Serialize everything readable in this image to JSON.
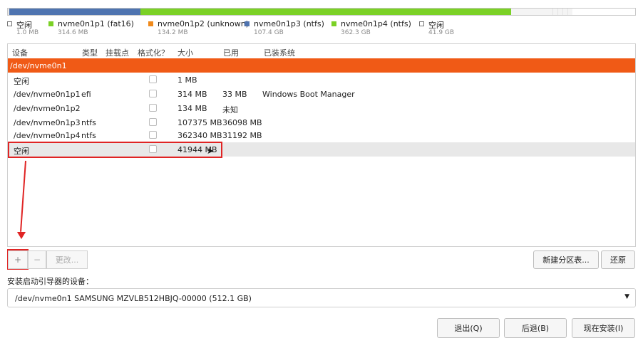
{
  "partition_bar": [
    {
      "color": "#e7e7e7",
      "fraction": 0.0019
    },
    {
      "color": "#4f74b0",
      "fraction": 0.21
    },
    {
      "color": "#7bd126",
      "fraction": 0.59
    },
    {
      "color": "#f4f4f4",
      "fraction": 0.06
    },
    {
      "color": "#f4f4f4",
      "fraction": 0.0381,
      "free": true
    }
  ],
  "legend": [
    {
      "name": "空闲",
      "size": "1.0 MB",
      "color": "#ffffff",
      "free": true
    },
    {
      "name": "nvme0n1p1 (fat16)",
      "size": "314.6 MB",
      "color": "#7bd126"
    },
    {
      "name": "nvme0n1p2 (unknown)",
      "size": "134.2 MB",
      "color": "#f08a1c"
    },
    {
      "name": "nvme0n1p3 (ntfs)",
      "size": "107.4 GB",
      "color": "#4f74b0"
    },
    {
      "name": "nvme0n1p4 (ntfs)",
      "size": "362.3 GB",
      "color": "#7bd126"
    },
    {
      "name": "空闲",
      "size": "41.9 GB",
      "color": "#ffffff",
      "free": true
    }
  ],
  "table": {
    "headers": {
      "device": "设备",
      "type": "类型",
      "mount": "挂载点",
      "format": "格式化？",
      "size": "大小",
      "used": "已用",
      "system": "已装系统"
    },
    "device_row": "/dev/nvme0n1",
    "rows": [
      {
        "device": "空闲",
        "type": "",
        "size": "1 MB",
        "used": "",
        "system": ""
      },
      {
        "device": "/dev/nvme0n1p1",
        "type": "efi",
        "size": "314 MB",
        "used": "33 MB",
        "system": "Windows Boot Manager"
      },
      {
        "device": "/dev/nvme0n1p2",
        "type": "",
        "size": "134 MB",
        "used": "未知",
        "system": ""
      },
      {
        "device": "/dev/nvme0n1p3",
        "type": "ntfs",
        "size": "107375 MB",
        "used": "36098 MB",
        "system": ""
      },
      {
        "device": "/dev/nvme0n1p4",
        "type": "ntfs",
        "size": "362340 MB",
        "used": "31192 MB",
        "system": ""
      },
      {
        "device": "空闲",
        "type": "",
        "size": "41944 MB",
        "used": "",
        "system": ""
      }
    ]
  },
  "toolbar": {
    "add": "+",
    "remove": "−",
    "change": "更改...",
    "new_table": "新建分区表...",
    "revert": "还原"
  },
  "bootloader": {
    "label": "安装启动引导器的设备：",
    "value": "/dev/nvme0n1     SAMSUNG MZVLB512HBJQ-00000 (512.1 GB)"
  },
  "actions": {
    "quit": "退出(Q)",
    "back": "后退(B)",
    "install": "现在安装(I)"
  }
}
